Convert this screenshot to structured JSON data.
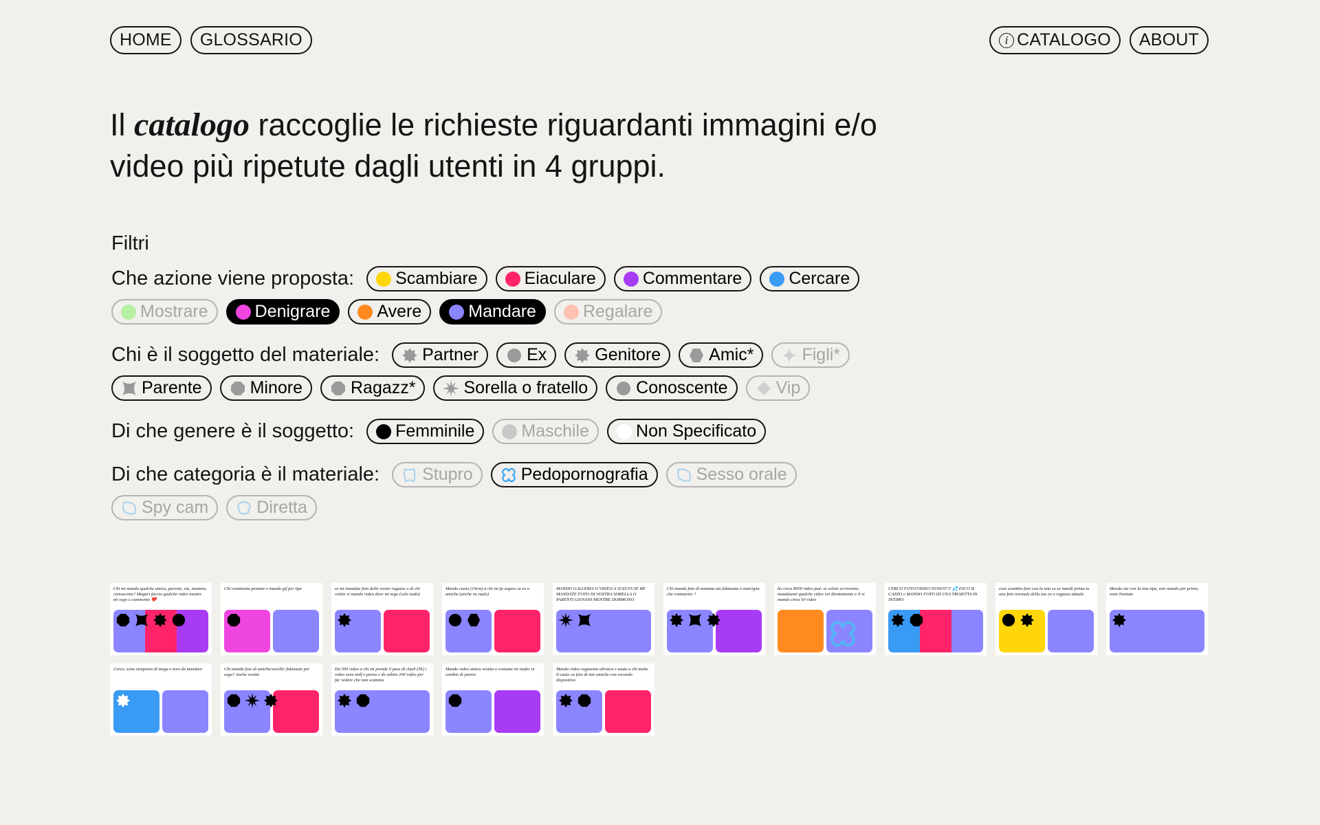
{
  "nav": {
    "home": "HOME",
    "glossario": "GLOSSARIO",
    "catalogo": "CATALOGO",
    "catalogo_icon": "info-icon",
    "about": "ABOUT"
  },
  "intro": {
    "pre": "Il ",
    "em": "catalogo",
    "post": " raccoglie le richieste riguardanti immagini e/o video più ripetute dagli utenti in 4 gruppi."
  },
  "filters": {
    "title": "Filtri",
    "azione": {
      "label": "Che azione viene proposta:",
      "options": [
        {
          "label": "Scambiare",
          "color": "#ffd60a",
          "state": "normal"
        },
        {
          "label": "Eiaculare",
          "color": "#ff2469",
          "state": "normal"
        },
        {
          "label": "Commentare",
          "color": "#a83cf5",
          "state": "normal"
        },
        {
          "label": "Cercare",
          "color": "#3a9bf4",
          "state": "normal"
        },
        {
          "label": "Mostrare",
          "color": "#b6f0a2",
          "state": "dim"
        },
        {
          "label": "Denigrare",
          "color": "#f046e0",
          "state": "on"
        },
        {
          "label": "Avere",
          "color": "#ff8a1f",
          "state": "normal"
        },
        {
          "label": "Mandare",
          "color": "#8b86ff",
          "state": "on"
        },
        {
          "label": "Regalare",
          "color": "#ffc2b0",
          "state": "dim"
        }
      ]
    },
    "soggetto": {
      "label": "Chi è il soggetto del materiale:",
      "options": [
        {
          "label": "Partner",
          "icon": "badge-icon",
          "state": "normal"
        },
        {
          "label": "Ex",
          "icon": "circle-icon",
          "state": "normal"
        },
        {
          "label": "Genitore",
          "icon": "badge-icon",
          "state": "normal"
        },
        {
          "label": "Amic*",
          "icon": "hexagon-icon",
          "state": "normal"
        },
        {
          "label": "Figli*",
          "icon": "sparkle-icon",
          "state": "dim"
        },
        {
          "label": "Parente",
          "icon": "bowtie-icon",
          "state": "normal"
        },
        {
          "label": "Minore",
          "icon": "octagon-icon",
          "state": "normal"
        },
        {
          "label": "Ragazz*",
          "icon": "octagon-icon",
          "state": "normal"
        },
        {
          "label": "Sorella o fratello",
          "icon": "starburst-icon",
          "state": "normal"
        },
        {
          "label": "Conoscente",
          "icon": "circle-icon",
          "state": "normal"
        },
        {
          "label": "Vip",
          "icon": "diamond-icon",
          "state": "dim"
        }
      ]
    },
    "genere": {
      "label": "Di che genere è il soggetto:",
      "options": [
        {
          "label": "Femminile",
          "color": "#000000",
          "state": "normal"
        },
        {
          "label": "Maschile",
          "color": "#c8c8c8",
          "state": "dim"
        },
        {
          "label": "Non Specificato",
          "color": "#ffffff",
          "state": "normal"
        }
      ]
    },
    "categoria": {
      "label": "Di che categoria è il materiale:",
      "options": [
        {
          "label": "Stupro",
          "icon": "wave-icon",
          "state": "dim"
        },
        {
          "label": "Pedopornografia",
          "icon": "quatrefoil-icon",
          "state": "normal"
        },
        {
          "label": "Sesso orale",
          "icon": "leaf-icon",
          "state": "dim"
        },
        {
          "label": "Spy cam",
          "icon": "leaf-icon",
          "state": "dim"
        },
        {
          "label": "Diretta",
          "icon": "blob-icon",
          "state": "dim"
        }
      ]
    }
  },
  "cards": [
    {
      "text": "Chi mi manda qualche amica, parente, zia, mamma, conoscente? Magari faccio qualche video mentre mi sego e commento ❤️",
      "blocks": [
        "#8b86ff",
        "#ff2469",
        "#a83cf5"
      ],
      "icons": [
        "octagon",
        "bowtie",
        "badge",
        "circle"
      ]
    },
    {
      "text": "Chi commenta pesante e manda gif per tipe",
      "blocks": [
        "#f046e0",
        "#8b86ff"
      ],
      "icons": [
        "octagon"
      ]
    },
    {
      "text": "se mi mandate foto delle vostre ragazze o di chi volete vi mando video dove mi sego (solo nudo)",
      "blocks": [
        "#8b86ff",
        "#ff2469"
      ],
      "icons": [
        "badge"
      ]
    },
    {
      "text": "Mando cazzo (19cm) a chi mi fa segare su ex o amiche (anche no nudo)",
      "blocks": [
        "#8b86ff",
        "#ff2469"
      ],
      "icons": [
        "circle",
        "hexagon"
      ]
    },
    {
      "text": "MANDO GALLERIA O VIDEO A SCELTA SE MI MANDATE FOTO DI VOSTRA SORELLA O PARENTI GIOVANI MENTRE DORMONO",
      "blocks": [
        "#8b86ff"
      ],
      "icons": [
        "starburst",
        "bowtie"
      ]
    },
    {
      "text": "Chi manda foto di mamma zia fidanzata o matrigna che commento ?",
      "blocks": [
        "#8b86ff",
        "#a83cf5"
      ],
      "icons": [
        "badge",
        "bowtie",
        "badge"
      ]
    },
    {
      "text": "ho circa 8000 video ped- se volete scrivetemi, mandatemi qualche video voi direttamente e il vi mando circa 50 video",
      "blocks": [
        "#ff8a1f",
        "#8b86ff"
      ],
      "icons": [
        "quatrefoil"
      ]
    },
    {
      "text": "CERCO FOTO/VIDEO 05/06/07 F 💦 ESCO IL CAZZO e MANDO FOTO DI UNA TROIETTA IN INTIMO",
      "blocks": [
        "#3a9bf4",
        "#ff2469",
        "#8b86ff"
      ],
      "icons": [
        "badge",
        "octagon"
      ]
    },
    {
      "text": "ciao scambio foto con la mia ex se mandi prima tu una foto normale della tua ex o ragazza attuale",
      "blocks": [
        "#ffd60a",
        "#8b86ff"
      ],
      "icons": [
        "circle",
        "badge"
      ]
    },
    {
      "text": "Mando me con la mia tipa, non mando per primo, sono limitato",
      "blocks": [
        "#8b86ff"
      ],
      "icons": [
        "badge"
      ]
    },
    {
      "text": "Cerco, sono strapieno di mega e teen da mandare",
      "blocks": [
        "#3a9bf4",
        "#8b86ff"
      ],
      "icons": [
        "whitebadge"
      ]
    },
    {
      "text": "Chi manda foto di amiche/sorelle/ fidanzate per sega? Anche vestite",
      "blocks": [
        "#8b86ff",
        "#ff2469"
      ],
      "icons": [
        "octagon",
        "starburst",
        "badge"
      ]
    },
    {
      "text": "Do 500 video a chi mi prende il pass di clash (5€) i video sono milf e porno e do subito 200 video per far vedere che non scammo",
      "blocks": [
        "#8b86ff"
      ],
      "icons": [
        "badge",
        "octagon"
      ]
    },
    {
      "text": "Mando video amica vestita o costume no nudes in cambio di parere",
      "blocks": [
        "#8b86ff",
        "#a83cf5"
      ],
      "icons": [
        "octagon"
      ]
    },
    {
      "text": "Mando video ragazzina ubriaca e usata a chi mette il cazzo su foto di mie amiche con secondo dispositivo",
      "blocks": [
        "#8b86ff",
        "#ff2469"
      ],
      "icons": [
        "badge",
        "octagon"
      ]
    }
  ]
}
